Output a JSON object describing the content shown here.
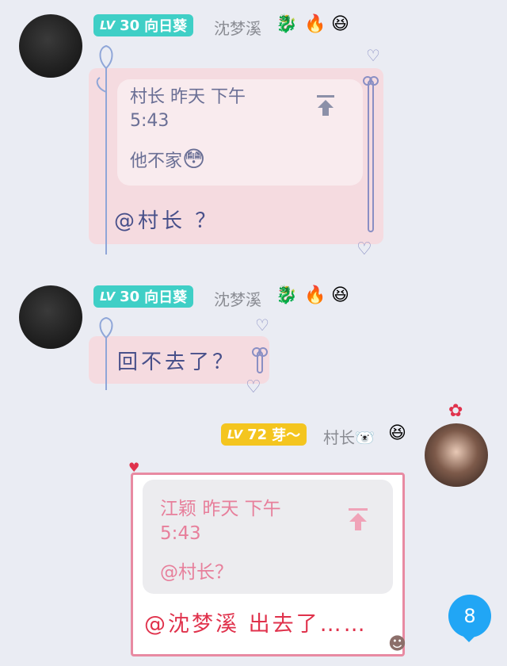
{
  "messages": [
    {
      "level_prefix": "LV",
      "level": "30",
      "title": "向日葵",
      "sender": "沈梦溪",
      "emojis": [
        "🐉",
        "🔥",
        "😆"
      ],
      "reply": {
        "author": "村长",
        "time": "昨天 下午",
        "time2": "5:43",
        "text": "他不家",
        "emoji": "😳"
      },
      "body": "@村长 ？"
    },
    {
      "level_prefix": "LV",
      "level": "30",
      "title": "向日葵",
      "sender": "沈梦溪",
      "emojis": [
        "🐉",
        "🔥",
        "😆"
      ],
      "body": "回不去了？"
    },
    {
      "level_prefix": "LV",
      "level": "72",
      "title": "芽～",
      "sender": "村长🐻‍❄️",
      "emojis": [
        "😆"
      ],
      "reply": {
        "author": "江颖",
        "time": "昨天 下午",
        "time2": "5:43",
        "text": "@村长？"
      },
      "body": "@沈梦溪 出去了……"
    }
  ],
  "unread_count": "8",
  "colors": {
    "teal": "#3fcfc6",
    "gold": "#f4c51f",
    "accent": "#21a6f5"
  }
}
